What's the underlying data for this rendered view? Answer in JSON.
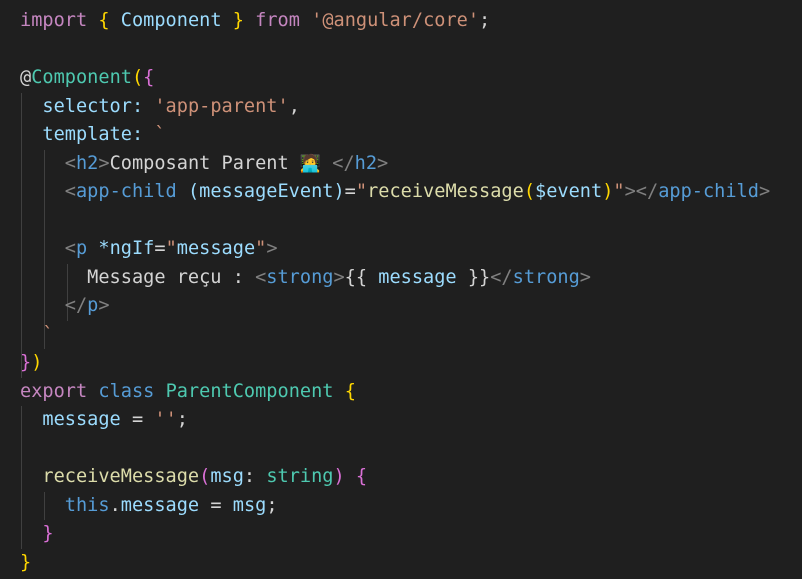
{
  "editor": {
    "language": "typescript",
    "colors": {
      "background": "#1f1f1f",
      "keyword": "#c586c0",
      "storage": "#569cd6",
      "variable": "#9cdcfe",
      "class_name": "#4ec9b0",
      "string": "#ce9178",
      "function": "#dcdcaa",
      "text": "#d4d4d4",
      "tag_bracket": "#808080",
      "bracket_gold": "#ffd700",
      "bracket_purple": "#da70d6",
      "bracket_blue": "#179fff",
      "indent_guide": "#404040"
    },
    "lines": [
      [
        {
          "t": "import",
          "c": "#c586c0"
        },
        {
          "t": " ",
          "c": "#d4d4d4"
        },
        {
          "t": "{",
          "c": "#ffd700"
        },
        {
          "t": " ",
          "c": "#d4d4d4"
        },
        {
          "t": "Component",
          "c": "#9cdcfe"
        },
        {
          "t": " ",
          "c": "#d4d4d4"
        },
        {
          "t": "}",
          "c": "#ffd700"
        },
        {
          "t": " ",
          "c": "#d4d4d4"
        },
        {
          "t": "from",
          "c": "#c586c0"
        },
        {
          "t": " ",
          "c": "#d4d4d4"
        },
        {
          "t": "'@angular/core'",
          "c": "#ce9178"
        },
        {
          "t": ";",
          "c": "#d4d4d4"
        }
      ],
      [],
      [
        {
          "t": "@",
          "c": "#d4d4d4"
        },
        {
          "t": "Component",
          "c": "#4ec9b0"
        },
        {
          "t": "(",
          "c": "#ffd700"
        },
        {
          "t": "{",
          "c": "#da70d6"
        }
      ],
      [
        {
          "t": "  ",
          "c": "#d4d4d4"
        },
        {
          "t": "selector",
          "c": "#9cdcfe"
        },
        {
          "t": ":",
          "c": "#9cdcfe"
        },
        {
          "t": " ",
          "c": "#d4d4d4"
        },
        {
          "t": "'app-parent'",
          "c": "#ce9178"
        },
        {
          "t": ",",
          "c": "#d4d4d4"
        }
      ],
      [
        {
          "t": "  ",
          "c": "#d4d4d4"
        },
        {
          "t": "template",
          "c": "#9cdcfe"
        },
        {
          "t": ":",
          "c": "#9cdcfe"
        },
        {
          "t": " ",
          "c": "#d4d4d4"
        },
        {
          "t": "`",
          "c": "#ce9178"
        }
      ],
      [
        {
          "t": "    ",
          "c": "#d4d4d4"
        },
        {
          "t": "<",
          "c": "#808080"
        },
        {
          "t": "h2",
          "c": "#569cd6"
        },
        {
          "t": ">",
          "c": "#808080"
        },
        {
          "t": "Composant Parent ",
          "c": "#d4d4d4"
        },
        {
          "t": "🧑‍💻",
          "c": "#d4d4d4",
          "emoji": true
        },
        {
          "t": " ",
          "c": "#d4d4d4"
        },
        {
          "t": "</",
          "c": "#808080"
        },
        {
          "t": "h2",
          "c": "#569cd6"
        },
        {
          "t": ">",
          "c": "#808080"
        }
      ],
      [
        {
          "t": "    ",
          "c": "#d4d4d4"
        },
        {
          "t": "<",
          "c": "#808080"
        },
        {
          "t": "app-child",
          "c": "#569cd6"
        },
        {
          "t": " ",
          "c": "#d4d4d4"
        },
        {
          "t": "(messageEvent)",
          "c": "#9cdcfe"
        },
        {
          "t": "=",
          "c": "#d4d4d4"
        },
        {
          "t": "\"",
          "c": "#ce9178"
        },
        {
          "t": "receiveMessage",
          "c": "#dcdcaa"
        },
        {
          "t": "(",
          "c": "#ffd700"
        },
        {
          "t": "$event",
          "c": "#9cdcfe"
        },
        {
          "t": ")",
          "c": "#ffd700"
        },
        {
          "t": "\"",
          "c": "#ce9178"
        },
        {
          "t": "></",
          "c": "#808080"
        },
        {
          "t": "app-child",
          "c": "#569cd6"
        },
        {
          "t": ">",
          "c": "#808080"
        }
      ],
      [],
      [
        {
          "t": "    ",
          "c": "#d4d4d4"
        },
        {
          "t": "<",
          "c": "#808080"
        },
        {
          "t": "p",
          "c": "#569cd6"
        },
        {
          "t": " ",
          "c": "#d4d4d4"
        },
        {
          "t": "*ngIf",
          "c": "#9cdcfe"
        },
        {
          "t": "=",
          "c": "#d4d4d4"
        },
        {
          "t": "\"",
          "c": "#ce9178"
        },
        {
          "t": "message",
          "c": "#9cdcfe"
        },
        {
          "t": "\"",
          "c": "#ce9178"
        },
        {
          "t": ">",
          "c": "#808080"
        }
      ],
      [
        {
          "t": "      ",
          "c": "#d4d4d4"
        },
        {
          "t": "Message reçu : ",
          "c": "#d4d4d4"
        },
        {
          "t": "<",
          "c": "#808080"
        },
        {
          "t": "strong",
          "c": "#569cd6"
        },
        {
          "t": ">",
          "c": "#808080"
        },
        {
          "t": "{{",
          "c": "#d4d4d4"
        },
        {
          "t": " ",
          "c": "#d4d4d4"
        },
        {
          "t": "message",
          "c": "#9cdcfe"
        },
        {
          "t": " ",
          "c": "#d4d4d4"
        },
        {
          "t": "}}",
          "c": "#d4d4d4"
        },
        {
          "t": "</",
          "c": "#808080"
        },
        {
          "t": "strong",
          "c": "#569cd6"
        },
        {
          "t": ">",
          "c": "#808080"
        }
      ],
      [
        {
          "t": "    ",
          "c": "#d4d4d4"
        },
        {
          "t": "</",
          "c": "#808080"
        },
        {
          "t": "p",
          "c": "#569cd6"
        },
        {
          "t": ">",
          "c": "#808080"
        }
      ],
      [
        {
          "t": "  ",
          "c": "#d4d4d4"
        },
        {
          "t": "`",
          "c": "#ce9178"
        }
      ],
      [
        {
          "t": "}",
          "c": "#da70d6"
        },
        {
          "t": ")",
          "c": "#ffd700"
        }
      ],
      [
        {
          "t": "export",
          "c": "#c586c0"
        },
        {
          "t": " ",
          "c": "#d4d4d4"
        },
        {
          "t": "class",
          "c": "#569cd6"
        },
        {
          "t": " ",
          "c": "#d4d4d4"
        },
        {
          "t": "ParentComponent",
          "c": "#4ec9b0"
        },
        {
          "t": " ",
          "c": "#d4d4d4"
        },
        {
          "t": "{",
          "c": "#ffd700"
        }
      ],
      [
        {
          "t": "  ",
          "c": "#d4d4d4"
        },
        {
          "t": "message",
          "c": "#9cdcfe"
        },
        {
          "t": " ",
          "c": "#d4d4d4"
        },
        {
          "t": "=",
          "c": "#d4d4d4"
        },
        {
          "t": " ",
          "c": "#d4d4d4"
        },
        {
          "t": "''",
          "c": "#ce9178"
        },
        {
          "t": ";",
          "c": "#d4d4d4"
        }
      ],
      [],
      [
        {
          "t": "  ",
          "c": "#d4d4d4"
        },
        {
          "t": "receiveMessage",
          "c": "#dcdcaa"
        },
        {
          "t": "(",
          "c": "#da70d6"
        },
        {
          "t": "msg",
          "c": "#9cdcfe"
        },
        {
          "t": ":",
          "c": "#d4d4d4"
        },
        {
          "t": " ",
          "c": "#d4d4d4"
        },
        {
          "t": "string",
          "c": "#4ec9b0"
        },
        {
          "t": ")",
          "c": "#da70d6"
        },
        {
          "t": " ",
          "c": "#d4d4d4"
        },
        {
          "t": "{",
          "c": "#da70d6"
        }
      ],
      [
        {
          "t": "    ",
          "c": "#d4d4d4"
        },
        {
          "t": "this",
          "c": "#569cd6"
        },
        {
          "t": ".",
          "c": "#d4d4d4"
        },
        {
          "t": "message",
          "c": "#9cdcfe"
        },
        {
          "t": " ",
          "c": "#d4d4d4"
        },
        {
          "t": "=",
          "c": "#d4d4d4"
        },
        {
          "t": " ",
          "c": "#d4d4d4"
        },
        {
          "t": "msg",
          "c": "#9cdcfe"
        },
        {
          "t": ";",
          "c": "#d4d4d4"
        }
      ],
      [
        {
          "t": "  ",
          "c": "#d4d4d4"
        },
        {
          "t": "}",
          "c": "#da70d6"
        }
      ],
      [
        {
          "t": "}",
          "c": "#ffd700"
        }
      ]
    ]
  }
}
